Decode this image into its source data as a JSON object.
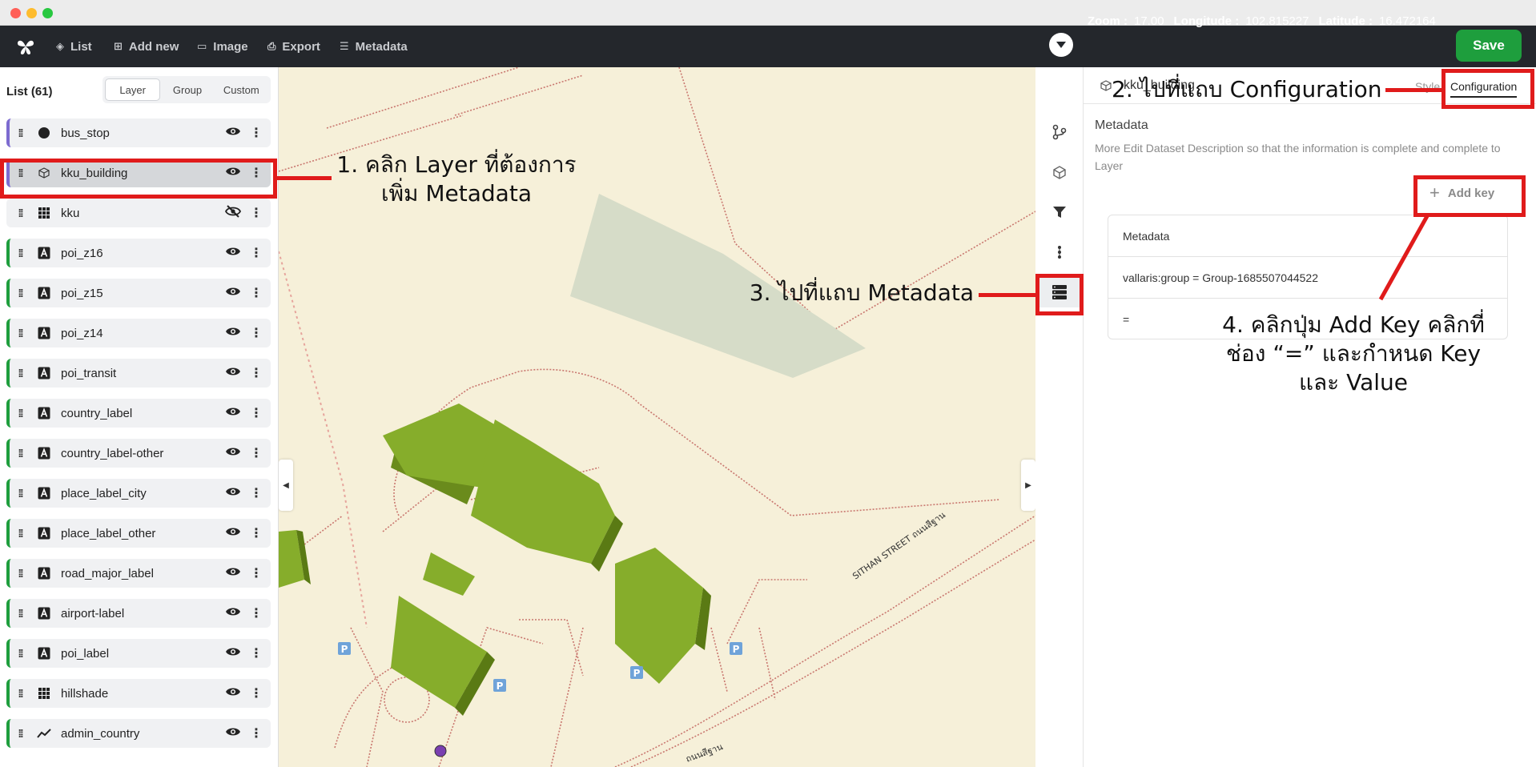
{
  "toolbar": {
    "items": [
      {
        "label": "List",
        "icon": "layers-icon"
      },
      {
        "label": "Add new",
        "icon": "plus-square-icon"
      },
      {
        "label": "Image",
        "icon": "image-icon"
      },
      {
        "label": "Export",
        "icon": "printer-icon"
      },
      {
        "label": "Metadata",
        "icon": "list-icon"
      }
    ],
    "zoom_label": "Zoom :",
    "zoom_value": "17.00",
    "longitude_label": "Longitude :",
    "longitude_value": "102.815227",
    "latitude_label": "Latitude :",
    "latitude_value": "16.472164",
    "save_label": "Save"
  },
  "sidebar": {
    "title": "List (61)",
    "segments": [
      "Layer",
      "Group",
      "Custom"
    ],
    "active_segment": "Layer",
    "layers": [
      {
        "name": "bus_stop",
        "type": "circle",
        "visible": true,
        "accent": "#7d6bd0"
      },
      {
        "name": "kku_building",
        "type": "fill-extrusion",
        "visible": true,
        "accent": "#7d6bd0",
        "selected": true
      },
      {
        "name": "kku",
        "type": "raster",
        "visible": false,
        "accent": "none"
      },
      {
        "name": "poi_z16",
        "type": "symbol",
        "visible": true,
        "accent": "#1e9e3d"
      },
      {
        "name": "poi_z15",
        "type": "symbol",
        "visible": true,
        "accent": "#1e9e3d"
      },
      {
        "name": "poi_z14",
        "type": "symbol",
        "visible": true,
        "accent": "#1e9e3d"
      },
      {
        "name": "poi_transit",
        "type": "symbol",
        "visible": true,
        "accent": "#1e9e3d"
      },
      {
        "name": "country_label",
        "type": "symbol",
        "visible": true,
        "accent": "#1e9e3d"
      },
      {
        "name": "country_label-other",
        "type": "symbol",
        "visible": true,
        "accent": "#1e9e3d"
      },
      {
        "name": "place_label_city",
        "type": "symbol",
        "visible": true,
        "accent": "#1e9e3d"
      },
      {
        "name": "place_label_other",
        "type": "symbol",
        "visible": true,
        "accent": "#1e9e3d"
      },
      {
        "name": "road_major_label",
        "type": "symbol",
        "visible": true,
        "accent": "#1e9e3d"
      },
      {
        "name": "airport-label",
        "type": "symbol",
        "visible": true,
        "accent": "#1e9e3d"
      },
      {
        "name": "poi_label",
        "type": "symbol",
        "visible": true,
        "accent": "#1e9e3d"
      },
      {
        "name": "hillshade",
        "type": "raster",
        "visible": true,
        "accent": "#1e9e3d"
      },
      {
        "name": "admin_country",
        "type": "line",
        "visible": true,
        "accent": "#1e9e3d"
      }
    ]
  },
  "map": {
    "street_label_1": "SITHAN STREET ถนนสีฐาน",
    "street_label_2": "ถนนสีฐาน",
    "parking_glyph": "P"
  },
  "panel": {
    "layer_name": "kku_building",
    "tabs": [
      "Style",
      "Configuration"
    ],
    "active_tab": "Configuration",
    "section_title": "Metadata",
    "description": "More Edit Dataset Description so that the information is complete and complete to Layer",
    "add_key_label": "Add key",
    "table": {
      "header": "Metadata",
      "rows": [
        "vallaris:group = Group-1685507044522",
        "="
      ]
    }
  },
  "annotations": {
    "step1": "1. คลิก Layer ที่ต้องการ\nเพิ่ม Metadata",
    "step2": "2. ไปที่แถบ Configuration",
    "step3": "3. ไปที่แถบ Metadata",
    "step4": "4. คลิกปุ่ม Add Key คลิกที่\nช่อง “=” และกำหนด Key\nและ Value"
  },
  "colors": {
    "topbar": "#24272c",
    "save": "#1e9e3d",
    "annotation_red": "#e01b1b",
    "building": "#86ad2b",
    "map_bg": "#f6f0d9"
  }
}
